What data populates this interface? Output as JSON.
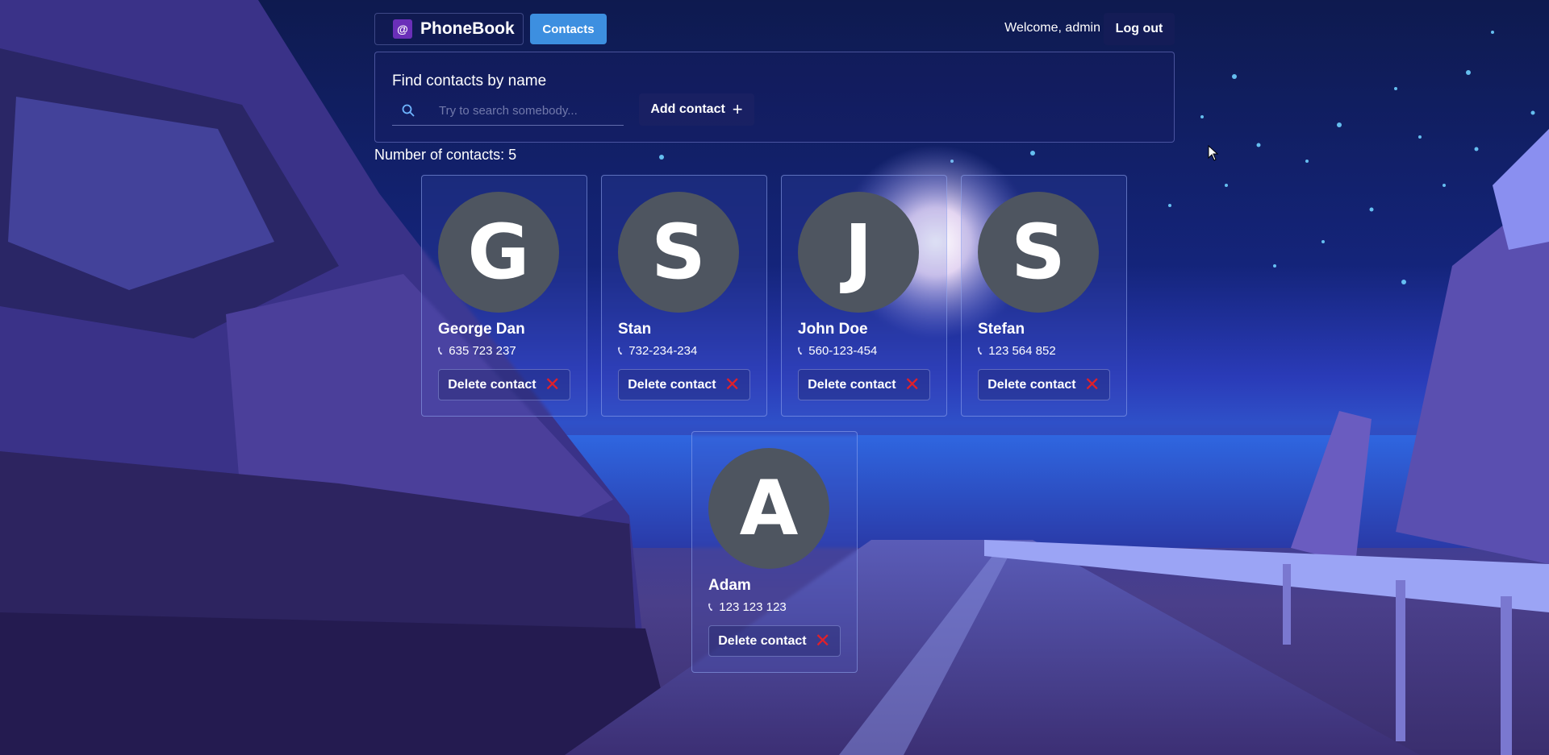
{
  "header": {
    "brand_icon": "@",
    "brand_name": "PhoneBook",
    "nav_contacts": "Contacts",
    "welcome": "Welcome, admin",
    "logout": "Log out"
  },
  "search": {
    "title": "Find contacts by name",
    "placeholder": "Try to search somebody...",
    "value": "",
    "add_contact": "Add contact",
    "add_icon": "+"
  },
  "count_text": "Number of contacts: 5",
  "contacts": [
    {
      "initial": "G",
      "name": "George Dan",
      "phone": "635 723 237",
      "delete": "Delete contact"
    },
    {
      "initial": "S",
      "name": "Stan",
      "phone": "732-234-234",
      "delete": "Delete contact"
    },
    {
      "initial": "J",
      "name": "John Doe",
      "phone": "560-123-454",
      "delete": "Delete contact"
    },
    {
      "initial": "S",
      "name": "Stefan",
      "phone": "123 564 852",
      "delete": "Delete contact"
    },
    {
      "initial": "A",
      "name": "Adam",
      "phone": "123 123 123",
      "delete": "Delete contact"
    }
  ],
  "icons": {
    "search": "search-icon",
    "phone": "phone-icon",
    "delete": "close-icon",
    "add": "plus-icon"
  },
  "colors": {
    "accent": "#3d8fe0",
    "avatar_bg": "#4e5560",
    "delete_x": "#e0202a",
    "brand_icon_bg": "#6a2fb8"
  }
}
